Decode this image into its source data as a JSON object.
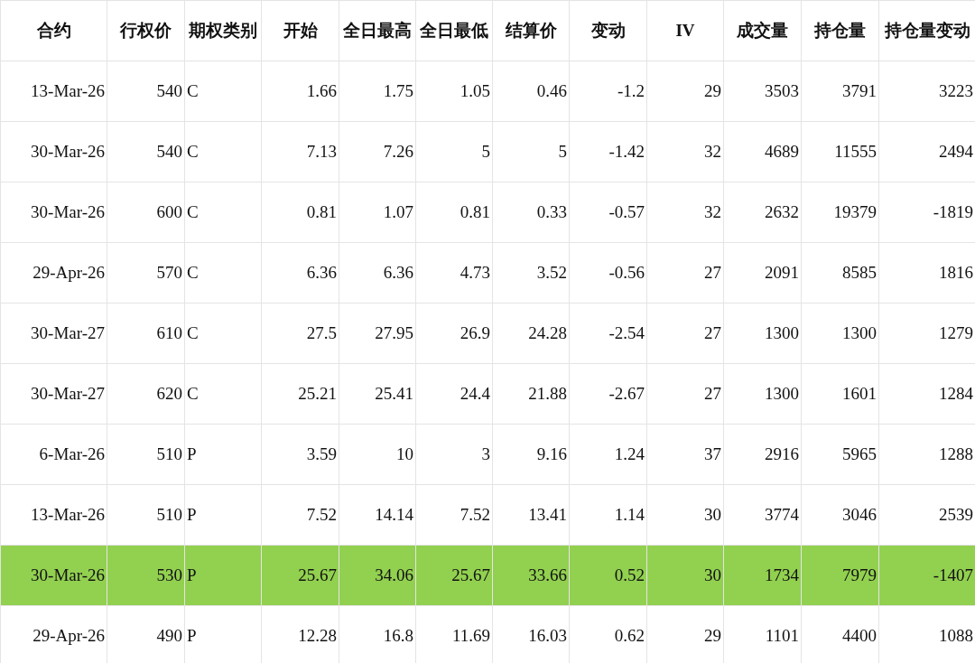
{
  "table": {
    "columns": [
      "合约",
      "行权价",
      "期权类别",
      "开始",
      "全日最高",
      "全日最低",
      "结算价",
      "变动",
      "IV",
      "成交量",
      "持仓量",
      "持仓量变动"
    ],
    "rows": [
      {
        "selected": false,
        "cells": [
          "13-Mar-26",
          "540",
          "C",
          "1.66",
          "1.75",
          "1.05",
          "0.46",
          "-1.2",
          "29",
          "3503",
          "3791",
          "3223"
        ]
      },
      {
        "selected": false,
        "cells": [
          "30-Mar-26",
          "540",
          "C",
          "7.13",
          "7.26",
          "5",
          "5",
          "-1.42",
          "32",
          "4689",
          "11555",
          "2494"
        ]
      },
      {
        "selected": false,
        "cells": [
          "30-Mar-26",
          "600",
          "C",
          "0.81",
          "1.07",
          "0.81",
          "0.33",
          "-0.57",
          "32",
          "2632",
          "19379",
          "-1819"
        ]
      },
      {
        "selected": false,
        "cells": [
          "29-Apr-26",
          "570",
          "C",
          "6.36",
          "6.36",
          "4.73",
          "3.52",
          "-0.56",
          "27",
          "2091",
          "8585",
          "1816"
        ]
      },
      {
        "selected": false,
        "cells": [
          "30-Mar-27",
          "610",
          "C",
          "27.5",
          "27.95",
          "26.9",
          "24.28",
          "-2.54",
          "27",
          "1300",
          "1300",
          "1279"
        ]
      },
      {
        "selected": false,
        "cells": [
          "30-Mar-27",
          "620",
          "C",
          "25.21",
          "25.41",
          "24.4",
          "21.88",
          "-2.67",
          "27",
          "1300",
          "1601",
          "1284"
        ]
      },
      {
        "selected": false,
        "cells": [
          "6-Mar-26",
          "510",
          "P",
          "3.59",
          "10",
          "3",
          "9.16",
          "1.24",
          "37",
          "2916",
          "5965",
          "1288"
        ]
      },
      {
        "selected": false,
        "cells": [
          "13-Mar-26",
          "510",
          "P",
          "7.52",
          "14.14",
          "7.52",
          "13.41",
          "1.14",
          "30",
          "3774",
          "3046",
          "2539"
        ]
      },
      {
        "selected": true,
        "cells": [
          "30-Mar-26",
          "530",
          "P",
          "25.67",
          "34.06",
          "25.67",
          "33.66",
          "0.52",
          "30",
          "1734",
          "7979",
          "-1407"
        ]
      },
      {
        "selected": false,
        "cells": [
          "29-Apr-26",
          "490",
          "P",
          "12.28",
          "16.8",
          "11.69",
          "16.03",
          "0.62",
          "29",
          "1101",
          "4400",
          "1088"
        ]
      }
    ]
  }
}
